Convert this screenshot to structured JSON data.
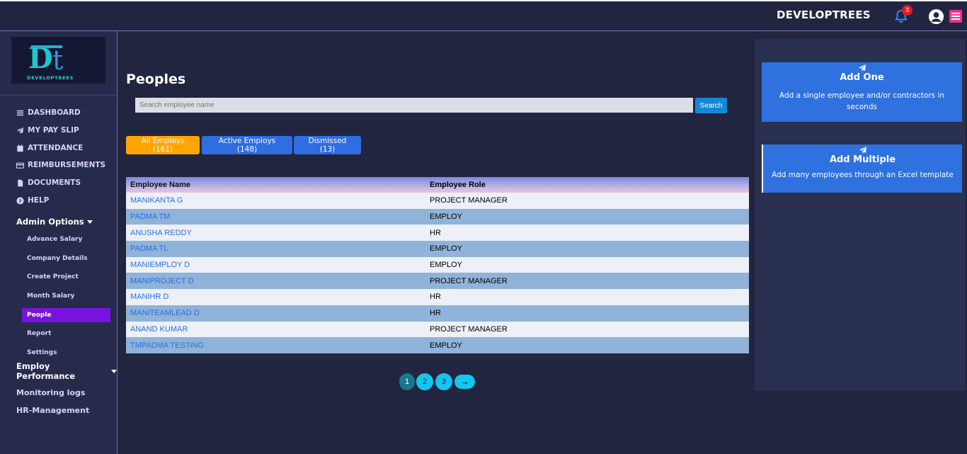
{
  "header": {
    "brand": "DEVELOPTREES",
    "notification_count": "3"
  },
  "sidebar": {
    "logo_text": "DEVELOPTREES",
    "nav": [
      {
        "label": "DASHBOARD",
        "icon": "list-icon"
      },
      {
        "label": "MY PAY SLIP",
        "icon": "paper-plane-icon"
      },
      {
        "label": "ATTENDANCE",
        "icon": "calendar-icon"
      },
      {
        "label": "REIMBURSEMENTS",
        "icon": "credit-card-icon"
      },
      {
        "label": "DOCUMENTS",
        "icon": "document-icon"
      },
      {
        "label": "HELP",
        "icon": "question-icon"
      }
    ],
    "admin_title": "Admin Options",
    "admin_items": [
      "Advance Salary",
      "Company Details",
      "Create Project",
      "Month Salary",
      "People",
      "Report",
      "Settings"
    ],
    "active_item": "People",
    "performance_title": "Employ Performance",
    "monitoring": "Monitoring logs",
    "hr": "HR-Management"
  },
  "main": {
    "title": "Peoples",
    "search": {
      "placeholder": "Search employee name",
      "button": "Search"
    },
    "filters": {
      "all": "All Employs (161)",
      "active": "Active Employs (148)",
      "dismissed": "Dismissed (13)"
    },
    "table": {
      "headers": [
        "Employee Name",
        "Employee Role"
      ],
      "rows": [
        [
          "MANIKANTA G",
          "PROJECT MANAGER"
        ],
        [
          "PADMA TM",
          "EMPLOY"
        ],
        [
          "ANUSHA REDDY",
          "HR"
        ],
        [
          "PADMA TL",
          "EMPLOY"
        ],
        [
          "MANIEMPLOY D",
          "EMPLOY"
        ],
        [
          "MANIPROJECT D",
          "PROJECT MANAGER"
        ],
        [
          "MANIHR D",
          "HR"
        ],
        [
          "MANITEAMLEAD D",
          "HR"
        ],
        [
          "ANAND KUMAR",
          "PROJECT MANAGER"
        ],
        [
          "TMPADMA TESTING",
          "EMPLOY"
        ]
      ]
    },
    "pagination": {
      "pages": [
        "1",
        "2",
        "3"
      ],
      "next": "→",
      "current": "1"
    }
  },
  "right": {
    "add_one": {
      "title": "Add One",
      "desc": "Add a single employee and/or contractors in seconds"
    },
    "add_multiple": {
      "title": "Add Multiple",
      "desc": "Add many employees through an Excel template"
    }
  },
  "colors": {
    "accent": "#7a12e0",
    "primary": "#2f71de",
    "warning": "#ffa500",
    "pager": "#13c6ef"
  }
}
